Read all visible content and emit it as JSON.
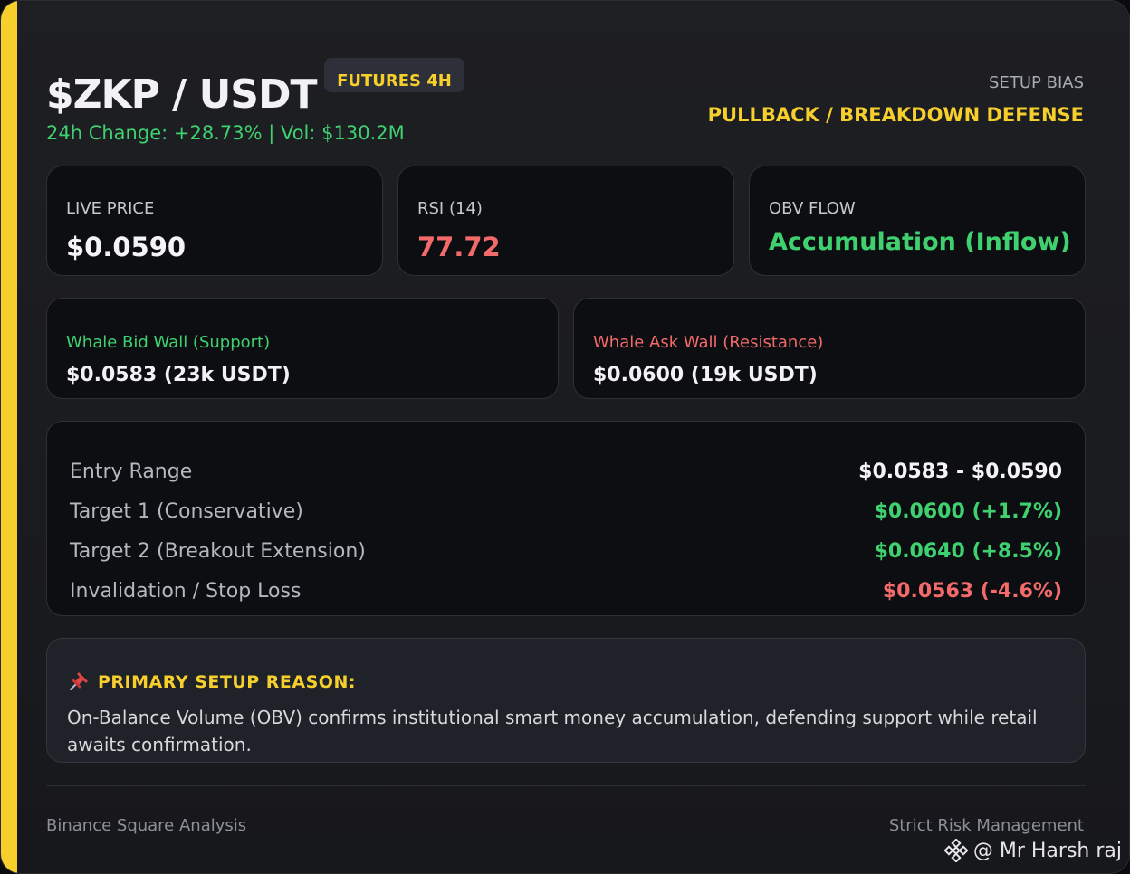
{
  "header": {
    "title": "$ZKP / USDT",
    "badge": "FUTURES 4H",
    "change": "24h Change: +28.73% | Vol: $130.2M",
    "bias_label": "SETUP BIAS",
    "bias_value": "PULLBACK / BREAKDOWN DEFENSE"
  },
  "stats": [
    {
      "label": "LIVE PRICE",
      "value": "$0.0590",
      "color": "#f4f4f6"
    },
    {
      "label": "RSI (14)",
      "value": "77.72",
      "color": "#f26a6a"
    },
    {
      "label": "OBV FLOW",
      "value": "Accumulation (Inflow)",
      "color": "#3fd170"
    }
  ],
  "walls": {
    "bid": {
      "label": "Whale Bid Wall (Support)",
      "value": "$0.0583 (23k USDT)",
      "color": "#3fd170"
    },
    "ask": {
      "label": "Whale Ask Wall (Resistance)",
      "value": "$0.0600 (19k USDT)",
      "color": "#f26a6a"
    }
  },
  "levels": [
    {
      "label": "Entry Range",
      "value": "$0.0583 - $0.0590",
      "color": "#f4f4f6"
    },
    {
      "label": "Target 1 (Conservative)",
      "value": "$0.0600 (+1.7%)",
      "color": "#3fd170"
    },
    {
      "label": "Target 2 (Breakout Extension)",
      "value": "$0.0640 (+8.5%)",
      "color": "#3fd170"
    },
    {
      "label": "Invalidation / Stop Loss",
      "value": "$0.0563 (-4.6%)",
      "color": "#f26a6a"
    }
  ],
  "reason": {
    "icon": "pushpin-icon",
    "title": "PRIMARY SETUP REASON:",
    "text": "On-Balance Volume (OBV) confirms institutional smart money accumulation, defending support while retail awaits confirmation."
  },
  "footer": {
    "left": "Binance Square Analysis",
    "right": "Strict Risk Management"
  },
  "watermark": {
    "icon": "binance-logo-icon",
    "text": "@ Mr Harsh raj"
  },
  "colors": {
    "accent": "#f7cf2d",
    "positive": "#3fd170",
    "negative": "#f26a6a"
  }
}
